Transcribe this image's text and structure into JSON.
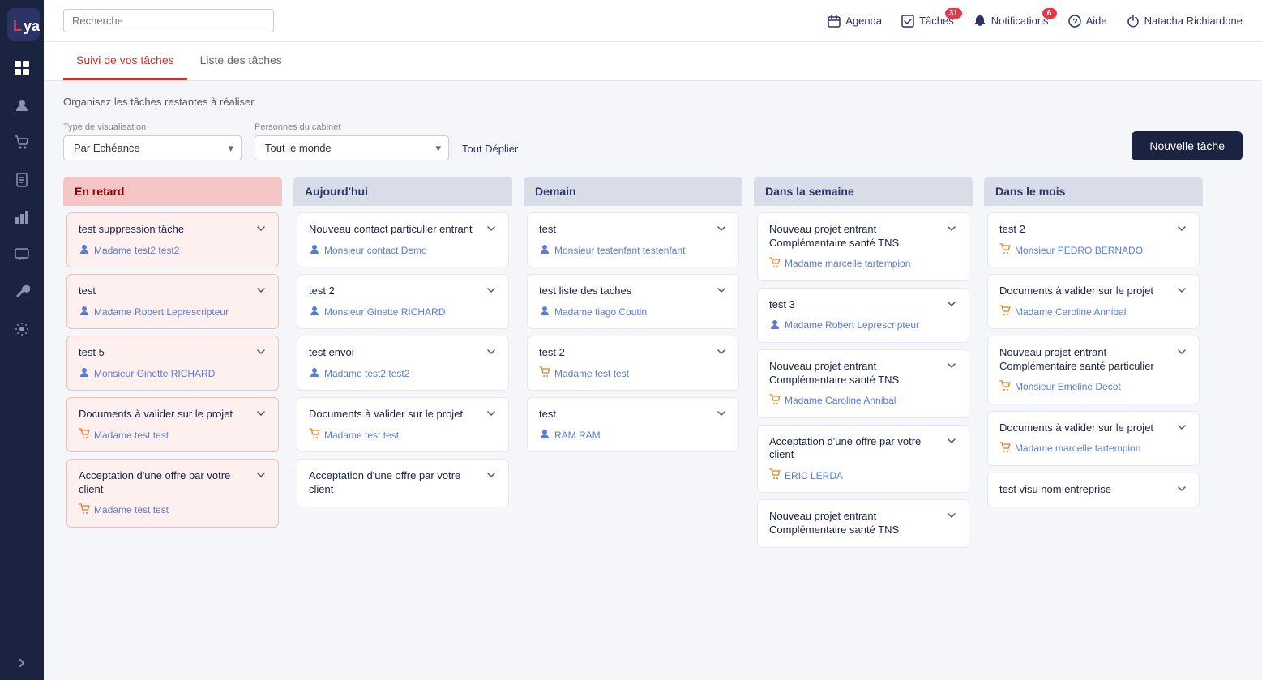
{
  "app": {
    "logo_text": "LYa"
  },
  "header": {
    "search_placeholder": "Recherche",
    "nav": {
      "agenda": "Agenda",
      "taches": "Tâches",
      "taches_badge": "31",
      "notifications": "Notifications",
      "notifications_badge": "6",
      "aide": "Aide",
      "user": "Natacha Richiardone"
    }
  },
  "tabs": [
    {
      "label": "Suivi de vos tâches",
      "active": true
    },
    {
      "label": "Liste des tâches",
      "active": false
    }
  ],
  "page": {
    "subtitle": "Organisez les tâches restantes à réaliser",
    "filter_type_label": "Type de visualisation",
    "filter_type_value": "Par Echéance",
    "filter_persons_label": "Personnes du cabinet",
    "filter_persons_value": "Tout le monde",
    "tout_deplier": "Tout Déplier",
    "nouvelle_tache": "Nouvelle tâche"
  },
  "sidebar": {
    "icons": [
      "grid",
      "users",
      "cart",
      "file",
      "chart",
      "chat",
      "wrench",
      "gear"
    ],
    "expand": ">"
  },
  "columns": [
    {
      "id": "en-retard",
      "title": "En retard",
      "style": "en-retard",
      "cards": [
        {
          "title": "test suppression tâche",
          "person_name": "Madame test2 test2",
          "person_type": "user"
        },
        {
          "title": "test",
          "person_name": "Madame Robert Leprescripteur",
          "person_type": "user"
        },
        {
          "title": "test 5",
          "person_name": "Monsieur Ginette RICHARD",
          "person_type": "user"
        },
        {
          "title": "Documents à valider sur le projet",
          "person_name": "Madame test test",
          "person_type": "cart"
        },
        {
          "title": "Acceptation d'une offre par votre client",
          "person_name": "Madame test test",
          "person_type": "cart"
        }
      ]
    },
    {
      "id": "aujourd-hui",
      "title": "Aujourd'hui",
      "style": "default",
      "cards": [
        {
          "title": "Nouveau contact particulier entrant",
          "person_name": "Monsieur contact Demo",
          "person_type": "user"
        },
        {
          "title": "test 2",
          "person_name": "Monsieur Ginette RICHARD",
          "person_type": "user"
        },
        {
          "title": "test envoi",
          "person_name": "Madame test2 test2",
          "person_type": "user"
        },
        {
          "title": "Documents à valider sur le projet",
          "person_name": "Madame test test",
          "person_type": "cart"
        },
        {
          "title": "Acceptation d'une offre par votre client",
          "person_name": "",
          "person_type": "user"
        }
      ]
    },
    {
      "id": "demain",
      "title": "Demain",
      "style": "default",
      "cards": [
        {
          "title": "test",
          "person_name": "Monsieur testenfant testenfant",
          "person_type": "user"
        },
        {
          "title": "test liste des taches",
          "person_name": "Madame tiago Coutin",
          "person_type": "user"
        },
        {
          "title": "test 2",
          "person_name": "Madame test test",
          "person_type": "cart"
        },
        {
          "title": "test",
          "person_name": "RAM RAM",
          "person_type": "user"
        }
      ]
    },
    {
      "id": "dans-la-semaine",
      "title": "Dans la semaine",
      "style": "default",
      "cards": [
        {
          "title": "Nouveau projet entrant Complémentaire santé TNS",
          "person_name": "Madame marcelle tartempion",
          "person_type": "cart"
        },
        {
          "title": "test 3",
          "person_name": "Madame Robert Leprescripteur",
          "person_type": "user"
        },
        {
          "title": "Nouveau projet entrant Complémentaire santé TNS",
          "person_name": "Madame Caroline Annibal",
          "person_type": "cart"
        },
        {
          "title": "Acceptation d'une offre par votre client",
          "person_name": "ERIC LERDA",
          "person_type": "cart"
        },
        {
          "title": "Nouveau projet entrant Complémentaire santé TNS",
          "person_name": "",
          "person_type": "cart"
        }
      ]
    },
    {
      "id": "dans-le-mois",
      "title": "Dans le mois",
      "style": "default",
      "cards": [
        {
          "title": "test 2",
          "person_name": "Monsieur PEDRO BERNADO",
          "person_type": "cart"
        },
        {
          "title": "Documents à valider sur le projet",
          "person_name": "Madame Caroline Annibal",
          "person_type": "cart"
        },
        {
          "title": "Nouveau projet entrant Complémentaire santé particulier",
          "person_name": "Monsieur Emeline Decot",
          "person_type": "cart"
        },
        {
          "title": "Documents à valider sur le projet",
          "person_name": "Madame marcelle tartempion",
          "person_type": "cart"
        },
        {
          "title": "test visu nom entreprise",
          "person_name": "",
          "person_type": "user"
        }
      ]
    }
  ]
}
